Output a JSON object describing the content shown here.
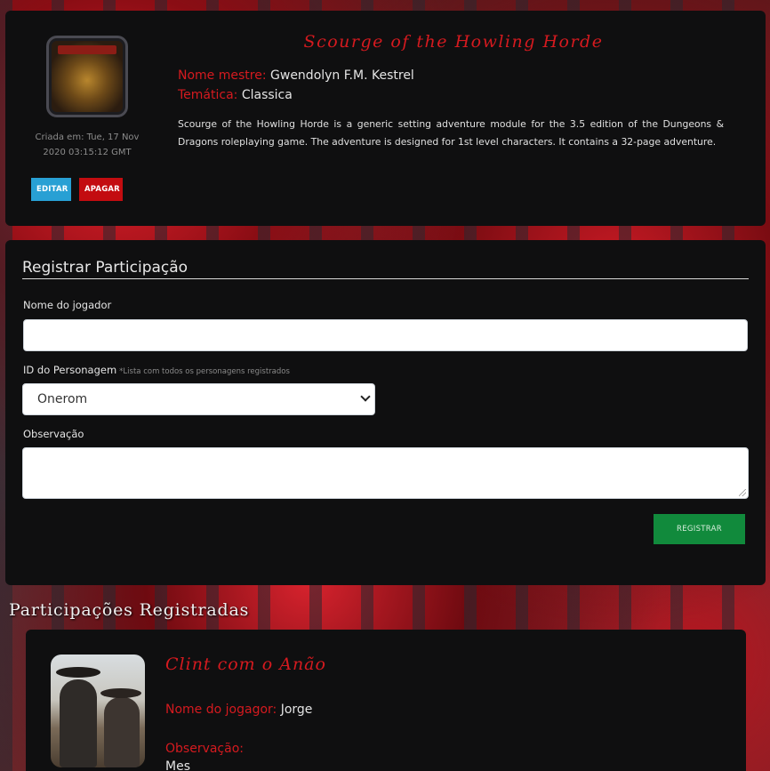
{
  "adventure": {
    "title": "Scourge of the Howling Horde",
    "created_label": "Criada em: Tue, 17 Nov 2020 03:15:12 GMT",
    "master_label": "Nome mestre:",
    "master_value": "Gwendolyn F.M. Kestrel",
    "theme_label": "Temática:",
    "theme_value": "Classica",
    "description": "Scourge of the Howling Horde is a generic setting adventure module for the 3.5 edition of the Dungeons & Dragons roleplaying game. The adventure is designed for 1st level characters. It contains a 32-page adventure.",
    "edit_label": "EDITAR",
    "delete_label": "APAGAR"
  },
  "form": {
    "heading": "Registrar Participação",
    "player_label": "Nome do jogador",
    "player_value": "",
    "character_label": "ID do Personagem",
    "character_hint": "*Lista com todos os personagens registrados",
    "character_selected": "Onerom",
    "notes_label": "Observação",
    "notes_value": "",
    "submit_label": "REGISTRAR"
  },
  "participations": {
    "heading": "Participações Registradas",
    "items": [
      {
        "character_name": "Clint com o Anão",
        "player_label": "Nome do jogagor:",
        "player_value": "Jorge",
        "notes_label": "Observação:",
        "notes_value": "Mes"
      }
    ]
  },
  "colors": {
    "accent_red": "#d51a1f",
    "edit_button": "#28a0d4",
    "delete_button": "#c30c10",
    "submit_button": "#118a3c",
    "card_bg": "#0f0f10"
  }
}
